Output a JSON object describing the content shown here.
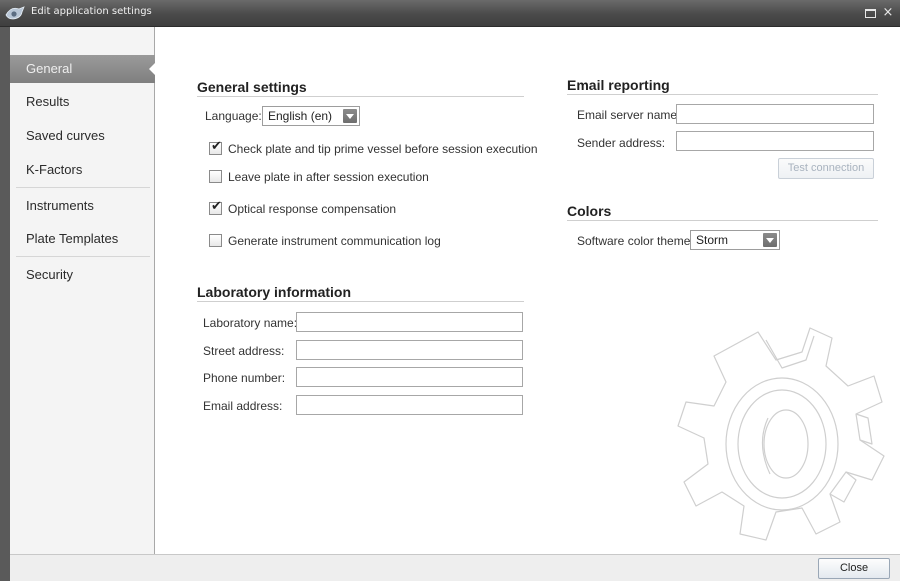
{
  "window": {
    "title": "Edit application settings",
    "icons": {
      "app": "app-eye-icon",
      "maximize": "maximize-icon",
      "close": "close-icon"
    },
    "close_glyph": "×"
  },
  "sidebar": {
    "items": [
      {
        "label": "General",
        "active": true
      },
      {
        "label": "Results"
      },
      {
        "label": "Saved curves"
      },
      {
        "label": "K-Factors"
      },
      {
        "label": "Instruments"
      },
      {
        "label": "Plate Templates"
      },
      {
        "label": "Security"
      }
    ]
  },
  "general_settings": {
    "title": "General settings",
    "language_label": "Language:",
    "language_value": "English (en)",
    "checkboxes": [
      {
        "label": "Check plate and tip prime vessel before session execution",
        "checked": true
      },
      {
        "label": "Leave plate in after session execution",
        "checked": false
      },
      {
        "label": "Optical response compensation",
        "checked": true
      },
      {
        "label": "Generate instrument communication log",
        "checked": false
      }
    ],
    "check_glyph": "✔"
  },
  "laboratory": {
    "title": "Laboratory information",
    "fields": [
      {
        "label": "Laboratory name:",
        "value": ""
      },
      {
        "label": "Street address:",
        "value": ""
      },
      {
        "label": "Phone number:",
        "value": ""
      },
      {
        "label": "Email address:",
        "value": ""
      }
    ]
  },
  "email": {
    "title": "Email reporting",
    "server_label": "Email server name:",
    "server_value": "",
    "sender_label": "Sender address:",
    "sender_value": "",
    "test_button": "Test connection"
  },
  "colors": {
    "title": "Colors",
    "theme_label": "Software color theme:",
    "theme_value": "Storm"
  },
  "footer": {
    "close_button": "Close"
  },
  "decor": {
    "gear": "gear-icon"
  },
  "palette": {
    "titlebar": "#4a4a4a",
    "active_nav": "#8c8c8c",
    "accent": "#9aa7b6"
  }
}
